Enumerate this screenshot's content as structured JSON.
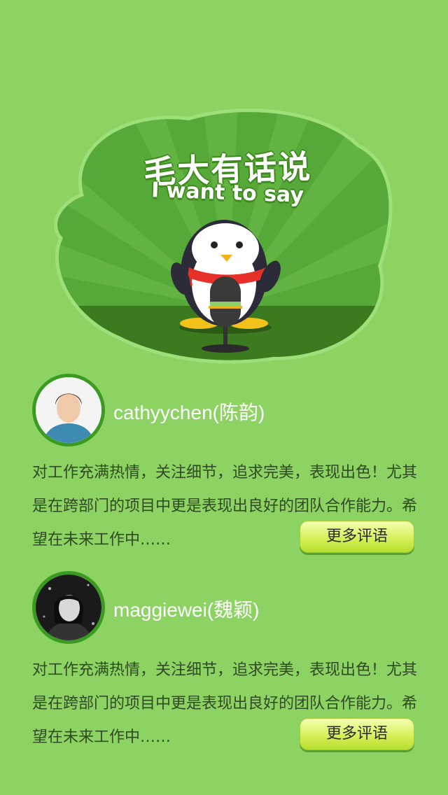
{
  "hero": {
    "title": "毛大有话说",
    "subtitle": "I want to say",
    "mascot_icon": "penguin-microphone-icon"
  },
  "reviews": [
    {
      "name": "cathyychen(陈韵)",
      "text": "对工作充满热情，关注细节，追求完美，表现出色！尤其是在跨部门的项目中更是表现出良好的团队合作能力。希望在未来工作中……",
      "more_label": "更多评语"
    },
    {
      "name": "maggiewei(魏颖)",
      "text": "对工作充满热情，关注细节，追求完美，表现出色！尤其是在跨部门的项目中更是表现出良好的团队合作能力。希望在未来工作中……",
      "more_label": "更多评语"
    }
  ],
  "colors": {
    "background": "#8dd363",
    "badge_dark": "#5aa83a",
    "ground": "#3b7a1e",
    "button": "#d6f05a",
    "avatar_border": "#3a9a22"
  }
}
